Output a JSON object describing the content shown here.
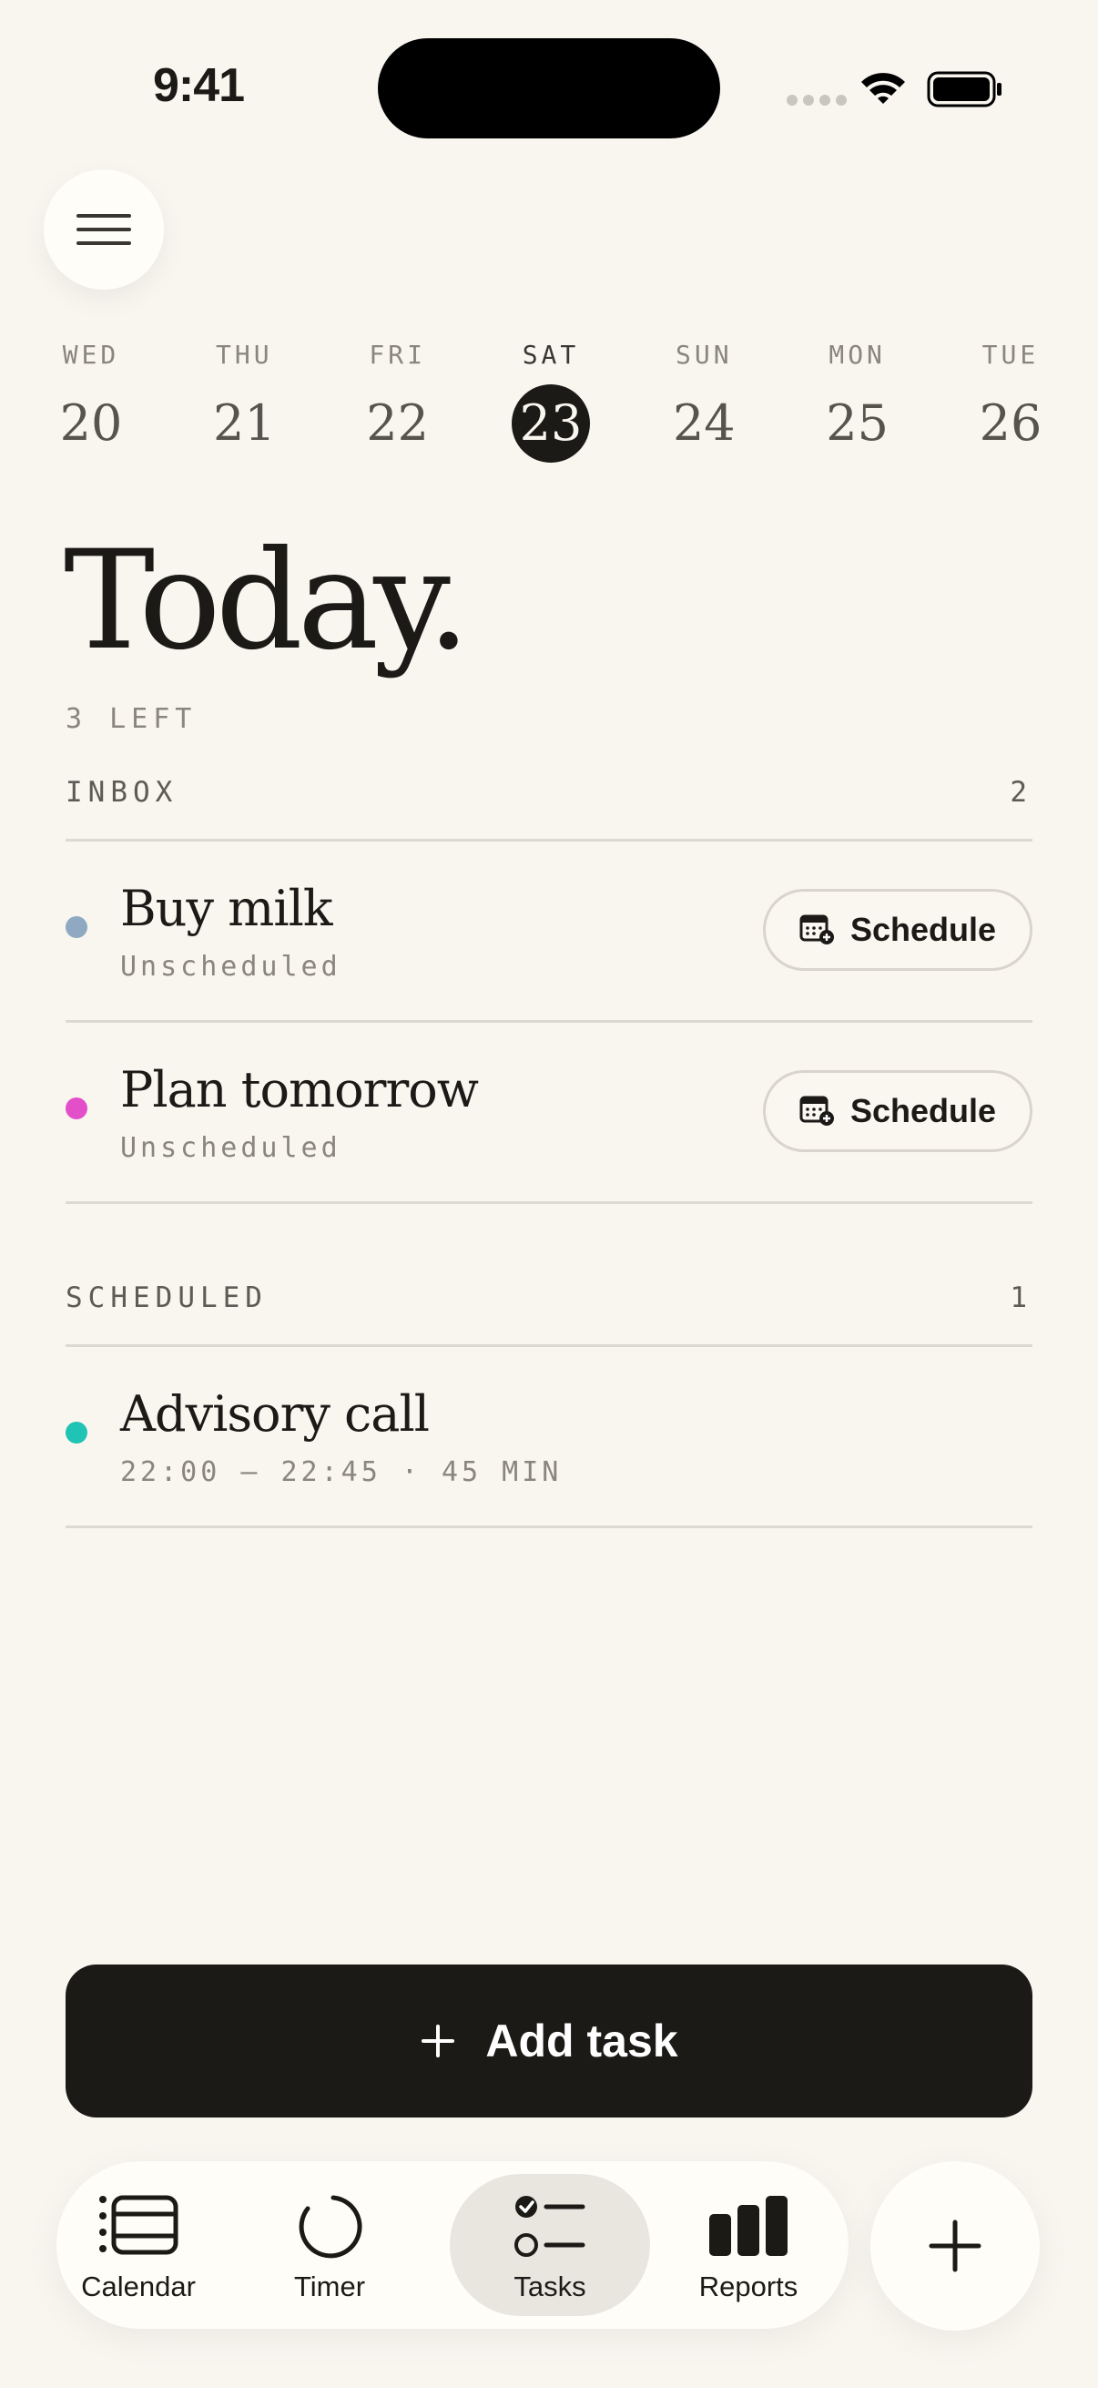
{
  "status": {
    "time": "9:41"
  },
  "week": [
    {
      "name": "WED",
      "num": "20"
    },
    {
      "name": "THU",
      "num": "21"
    },
    {
      "name": "FRI",
      "num": "22"
    },
    {
      "name": "SAT",
      "num": "23",
      "selected": true
    },
    {
      "name": "SUN",
      "num": "24"
    },
    {
      "name": "MON",
      "num": "25"
    },
    {
      "name": "TUE",
      "num": "26"
    }
  ],
  "page": {
    "title": "Today.",
    "left_count": "3 LEFT"
  },
  "inbox": {
    "label": "INBOX",
    "count": "2",
    "tasks": [
      {
        "name": "Buy milk",
        "sub": "Unscheduled",
        "color": "#8fa9c2",
        "button": "Schedule"
      },
      {
        "name": "Plan tomorrow",
        "sub": "Unscheduled",
        "color": "#e24fc9",
        "button": "Schedule"
      }
    ]
  },
  "scheduled": {
    "label": "SCHEDULED",
    "count": "1",
    "tasks": [
      {
        "name": "Advisory call",
        "sub": "22:00 — 22:45 · 45 MIN",
        "color": "#1fc4b4"
      }
    ]
  },
  "add_task": {
    "label": "Add task",
    "icon": "plus-icon"
  },
  "tabs": [
    {
      "label": "Calendar",
      "icon": "calendar-list-icon"
    },
    {
      "label": "Timer",
      "icon": "timer-ring-icon"
    },
    {
      "label": "Tasks",
      "icon": "tasks-checklist-icon",
      "active": true
    },
    {
      "label": "Reports",
      "icon": "bar-chart-icon"
    }
  ],
  "fab": {
    "icon": "plus-icon"
  }
}
